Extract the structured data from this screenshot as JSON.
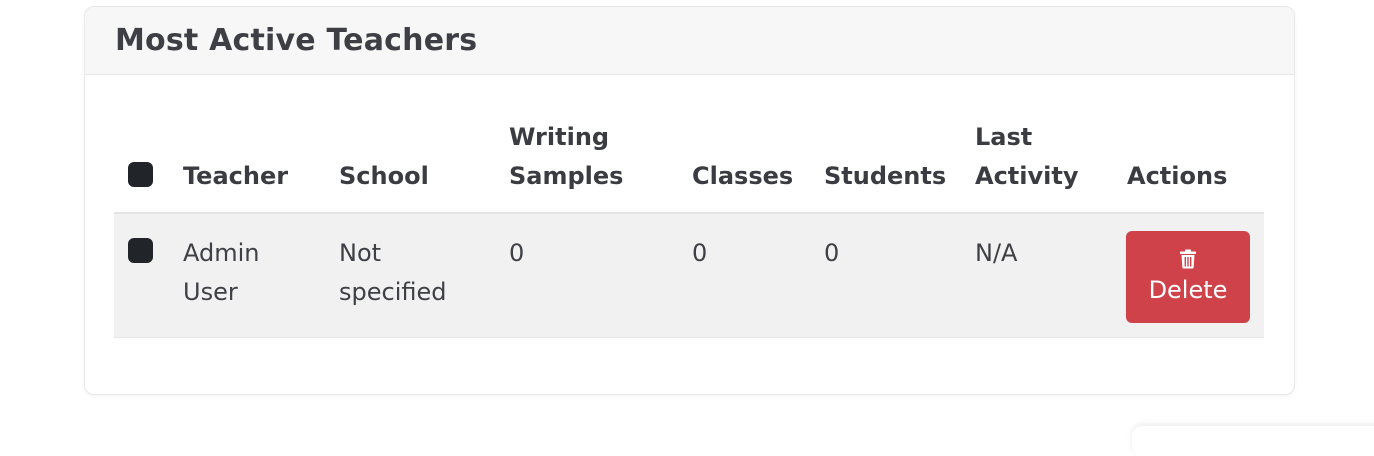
{
  "card": {
    "title": "Most Active Teachers"
  },
  "table": {
    "headers": {
      "teacher": "Teacher",
      "school": "School",
      "writing_samples_line1": "Writing",
      "writing_samples_line2": "Samples",
      "classes": "Classes",
      "students": "Students",
      "last_activity_line1": "Last",
      "last_activity_line2": "Activity",
      "actions": "Actions"
    },
    "rows": [
      {
        "teacher_line1": "Admin",
        "teacher_line2": "User",
        "school_line1": "Not",
        "school_line2": "specified",
        "writing_samples": "0",
        "classes": "0",
        "students": "0",
        "last_activity": "N/A",
        "action_label": "Delete",
        "action_icon": "trash-icon"
      }
    ]
  },
  "colors": {
    "delete_button": "#cf4249",
    "checkbox": "#212529",
    "row_background": "#f1f1f1",
    "header_background": "#f7f7f7"
  }
}
